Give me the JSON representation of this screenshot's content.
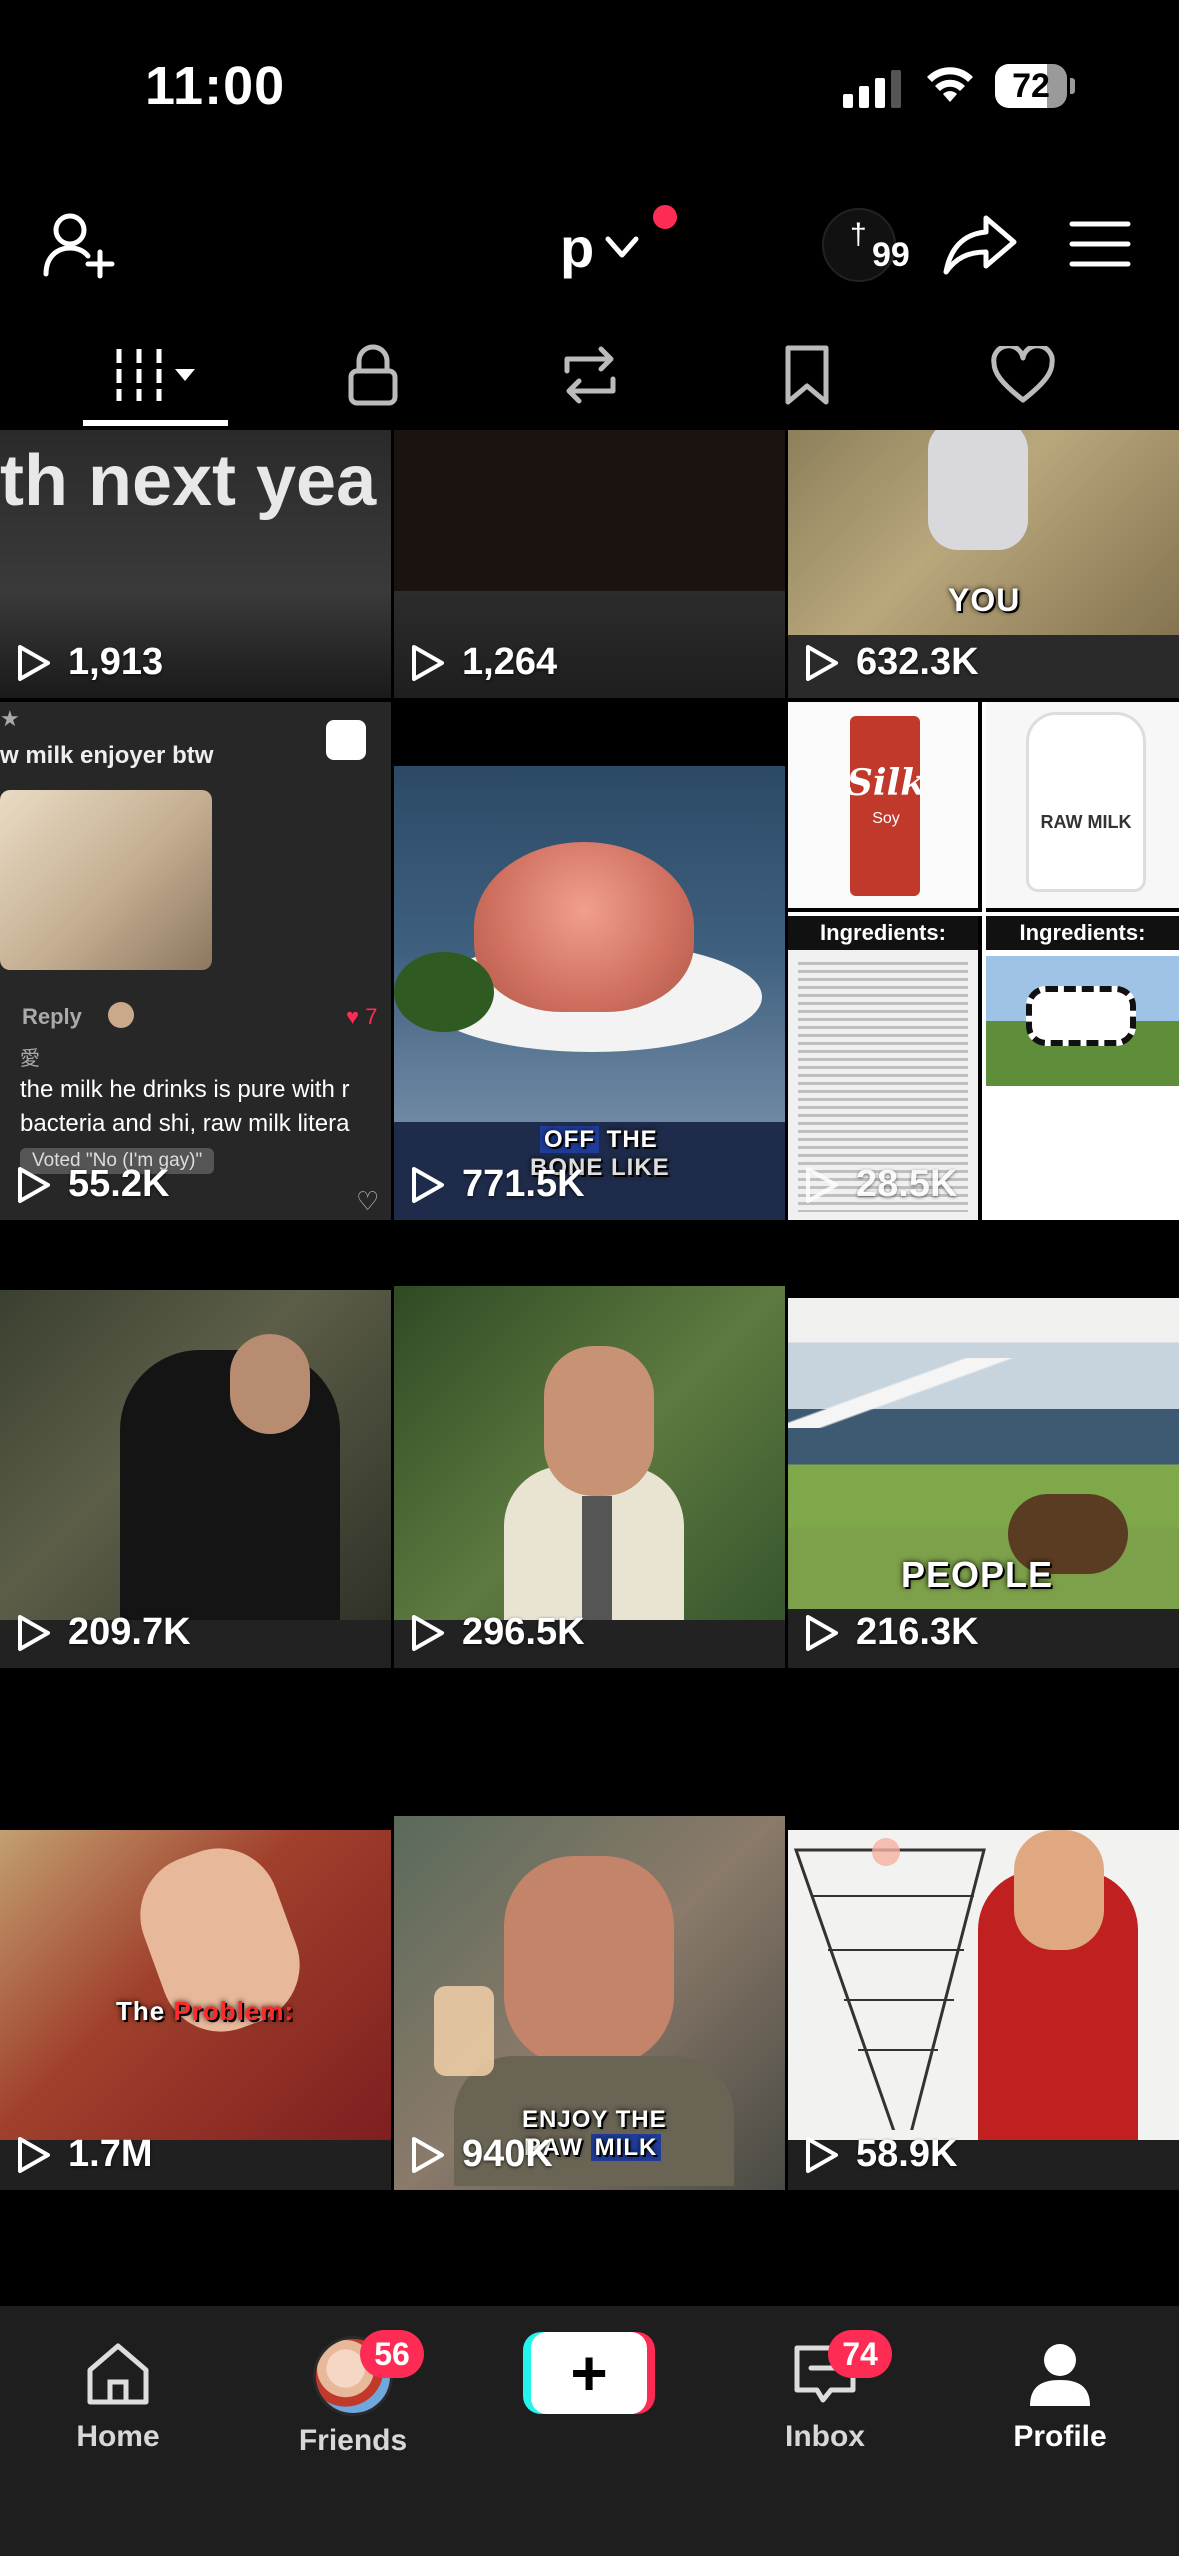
{
  "status_bar": {
    "time": "11:00",
    "battery": "72",
    "battery_level": 0.72
  },
  "header": {
    "username": "p",
    "avatar_count": "99"
  },
  "tabs": [
    {
      "name": "videos",
      "icon": "grid-icon",
      "active": true
    },
    {
      "name": "private",
      "icon": "lock-icon"
    },
    {
      "name": "reposts",
      "icon": "repost-icon"
    },
    {
      "name": "favorites",
      "icon": "bookmark-icon"
    },
    {
      "name": "liked",
      "icon": "heart-icon"
    }
  ],
  "videos": [
    {
      "views": "1,913",
      "caption": "th next yea"
    },
    {
      "views": "1,264"
    },
    {
      "views": "632.3K",
      "caption": "YOU"
    },
    {
      "views": "55.2K",
      "comment": {
        "header": "w milk enjoyer btw",
        "reply": "Reply",
        "author": "愛",
        "text1": "the milk he drinks is pure with r",
        "text2": "bacteria and shi, raw milk litera",
        "poll": "Voted \"No (I'm gay)\"",
        "likes": "7"
      }
    },
    {
      "views": "771.5K",
      "caption1a": "OFF",
      "caption1b": "THE",
      "caption2": "BONE LIKE"
    },
    {
      "views": "28.5K",
      "labels": {
        "silk": "Silk",
        "soy": "Soy",
        "raw_milk": "RAW MILK",
        "ingredients": "Ingredients:"
      }
    },
    {
      "views": "209.7K"
    },
    {
      "views": "296.5K"
    },
    {
      "views": "216.3K",
      "caption": "PEOPLE"
    },
    {
      "views": "1.7M",
      "caption_a": "The",
      "caption_b": "Problem:"
    },
    {
      "views": "940K",
      "caption1": "ENJOY THE",
      "caption2a": "RAW",
      "caption2b": "MILK"
    },
    {
      "views": "58.9K"
    }
  ],
  "bottom_nav": {
    "home": "Home",
    "friends": "Friends",
    "friends_badge": "56",
    "inbox": "Inbox",
    "inbox_badge": "74",
    "profile": "Profile"
  }
}
